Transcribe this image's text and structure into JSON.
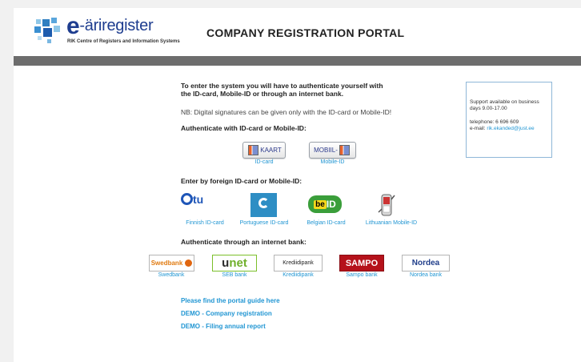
{
  "header": {
    "logo_prefix": "e",
    "logo_name": "-äriregister",
    "logo_subtitle": "RIK Centre of Registers and Information Systems",
    "portal_title": "COMPANY REGISTRATION PORTAL"
  },
  "intro": {
    "line1": "To enter the system you will have to authenticate yourself with",
    "line2": "the ID-card, Mobile-ID or through an internet bank.",
    "note": "NB: Digital signatures can be given only with the ID-card or Mobile-ID!"
  },
  "id_section": {
    "heading": "Authenticate with ID-card or Mobile-ID:",
    "buttons": [
      {
        "label": "KAART",
        "caption": "ID-card"
      },
      {
        "label": "MOBIIL-",
        "caption": "Mobile-ID"
      }
    ]
  },
  "foreign_section": {
    "heading": "Enter by foreign ID-card or Mobile-ID:",
    "items": [
      {
        "logo_text": "tu",
        "caption": "Finnish ID-card"
      },
      {
        "logo_text": "",
        "caption": "Portuguese ID-card"
      },
      {
        "logo_text": "be",
        "logo_text_2": "ID",
        "caption": "Belgian ID-card"
      },
      {
        "logo_text": "",
        "caption": "Lithuanian Mobile-ID"
      }
    ]
  },
  "bank_section": {
    "heading": "Authenticate through an internet bank:",
    "banks": [
      {
        "logo_text": "Swedbank",
        "caption": "Swedbank"
      },
      {
        "logo_text": "u",
        "logo_text_2": "net",
        "caption": "SEB bank"
      },
      {
        "logo_text": "Krediidipank",
        "caption": "Krediidipank"
      },
      {
        "logo_text": "SAMPO",
        "caption": "Sampo bank"
      },
      {
        "logo_text": "Nordea",
        "caption": "Nordea bank"
      }
    ]
  },
  "links": [
    {
      "label": "Please find the portal guide here"
    },
    {
      "label": "DEMO - Company registration"
    },
    {
      "label": "DEMO - Filing annual report"
    }
  ],
  "support": {
    "availability": "Support available on business days 9.00-17.00",
    "telephone": "telephone: 6 696 609",
    "email_label": "e-mail: ",
    "email": "rik.ekanded@just.ee"
  },
  "colors": {
    "accent": "#2196d3",
    "brand": "#1e3d8f",
    "rule": "#6d6d6d"
  }
}
